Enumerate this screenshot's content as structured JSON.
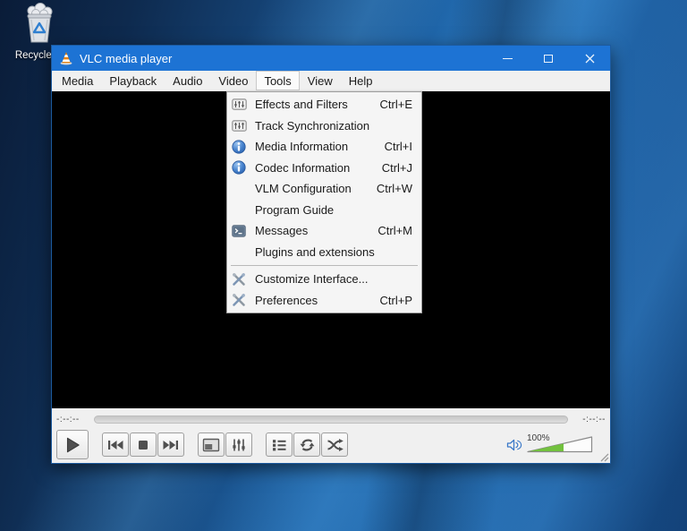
{
  "desktop": {
    "recycle_bin_label": "Recycle Bi"
  },
  "window": {
    "title": "VLC media player"
  },
  "menubar": {
    "items": [
      "Media",
      "Playback",
      "Audio",
      "Video",
      "Tools",
      "View",
      "Help"
    ],
    "active": "Tools"
  },
  "tools_menu": {
    "items": [
      {
        "icon": "effects-icon",
        "label": "Effects and Filters",
        "shortcut": "Ctrl+E"
      },
      {
        "icon": "effects-icon",
        "label": "Track Synchronization",
        "shortcut": ""
      },
      {
        "icon": "info-icon",
        "label": "Media Information",
        "shortcut": "Ctrl+I"
      },
      {
        "icon": "info-icon",
        "label": "Codec Information",
        "shortcut": "Ctrl+J"
      },
      {
        "icon": "",
        "label": "VLM Configuration",
        "shortcut": "Ctrl+W"
      },
      {
        "icon": "",
        "label": "Program Guide",
        "shortcut": ""
      },
      {
        "icon": "messages-icon",
        "label": "Messages",
        "shortcut": "Ctrl+M"
      },
      {
        "icon": "",
        "label": "Plugins and extensions",
        "shortcut": ""
      },
      {
        "icon": "tools-icon",
        "label": "Customize Interface...",
        "shortcut": ""
      },
      {
        "icon": "tools-icon",
        "label": "Preferences",
        "shortcut": "Ctrl+P"
      }
    ]
  },
  "transport": {
    "time_elapsed": "-:--:--",
    "time_total": "-:--:--",
    "volume_label": "100%"
  },
  "colors": {
    "titlebar_blue": "#1d73d4",
    "volume_green": "#72c13e",
    "info_icon_blue": "#3a78c8"
  }
}
